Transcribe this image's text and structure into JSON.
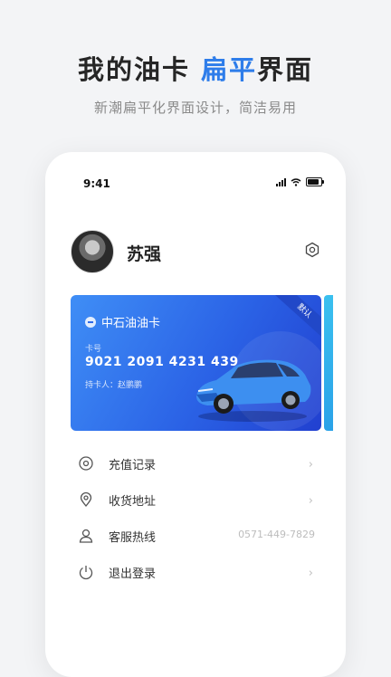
{
  "header": {
    "title_main": "我的油卡",
    "title_accent": "扁平",
    "title_end": "界面",
    "subtitle": "新潮扁平化界面设计，简洁易用"
  },
  "status_bar": {
    "time": "9:41"
  },
  "profile": {
    "name": "苏强"
  },
  "card": {
    "badge": "默认",
    "brand": "中石油油卡",
    "number_label": "卡号",
    "number": "9021 2091 4231 439",
    "holder": "持卡人：赵鹏鹏"
  },
  "menu": [
    {
      "label": "充值记录",
      "icon": "target-icon"
    },
    {
      "label": "收货地址",
      "icon": "location-icon"
    },
    {
      "label": "客服热线",
      "icon": "user-icon",
      "value": "0571-449-7829"
    },
    {
      "label": "退出登录",
      "icon": "power-icon"
    }
  ],
  "colors": {
    "accent": "#2e7dea",
    "card_start": "#3f8ef6",
    "card_end": "#2140d0"
  }
}
